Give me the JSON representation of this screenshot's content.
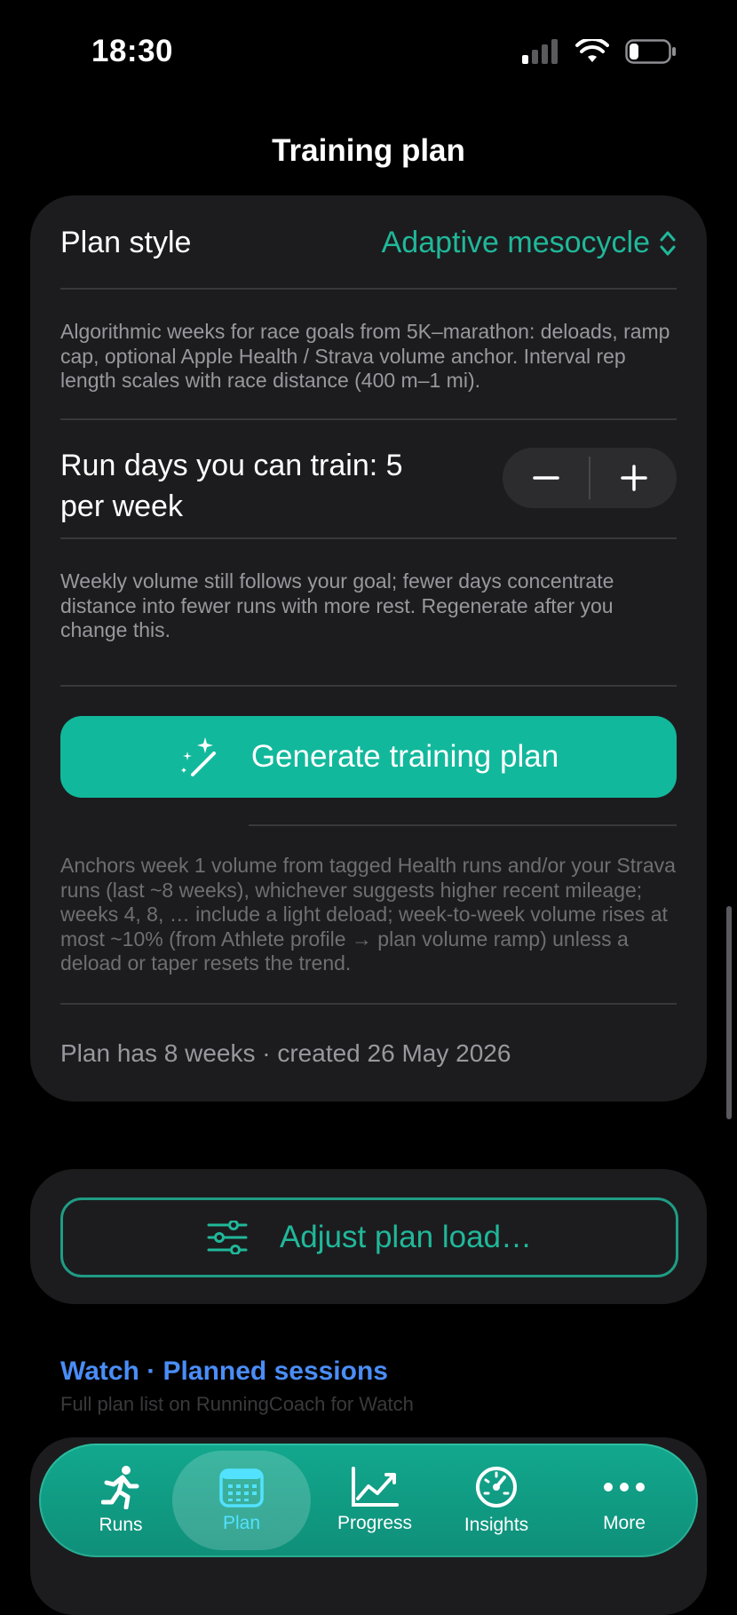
{
  "status_bar": {
    "time": "18:30"
  },
  "nav": {
    "title": "Training plan"
  },
  "plan_style": {
    "label": "Plan style",
    "value": "Adaptive mesocycle",
    "description": "Algorithmic weeks for race goals from 5K–marathon: deloads, ramp cap, optional Apple Health / Strava volume anchor. Interval rep length scales with race distance (400 m–1 mi)."
  },
  "run_days": {
    "label_line1": "Run days you can train: 5",
    "label_line2": "per week",
    "decrement_label": "−",
    "increment_label": "+",
    "description": "Weekly volume still follows your goal; fewer days concentrate distance into fewer runs with more rest. Regenerate after you change this."
  },
  "generate": {
    "label": "Generate training plan",
    "note": "Anchors week 1 volume from tagged Health runs and/or your Strava runs (last ~8 weeks), whichever suggests higher recent mileage; weeks 4, 8, … include a light deload; week-to-week volume rises at most ~10% (from Athlete profile → plan volume ramp) unless a deload or taper resets the trend."
  },
  "plan_summary": "Plan has 8 weeks · created 26 May 2026",
  "adjust": {
    "label": "Adjust plan load…"
  },
  "watch": {
    "title": "Watch · Planned sessions",
    "subtitle": "Full plan list on RunningCoach for Watch"
  },
  "tabs": [
    {
      "label": "Runs",
      "icon": "runner-icon"
    },
    {
      "label": "Plan",
      "icon": "calendar-icon",
      "active": true
    },
    {
      "label": "Progress",
      "icon": "chart-icon"
    },
    {
      "label": "Insights",
      "icon": "gauge-icon"
    },
    {
      "label": "More",
      "icon": "ellipsis-icon"
    }
  ],
  "colors": {
    "accent": "#12b89c",
    "accent_text": "#20b89a",
    "link_blue": "#4a8df8",
    "card": "#1c1c1e",
    "active_tab": "#52e2ff"
  }
}
